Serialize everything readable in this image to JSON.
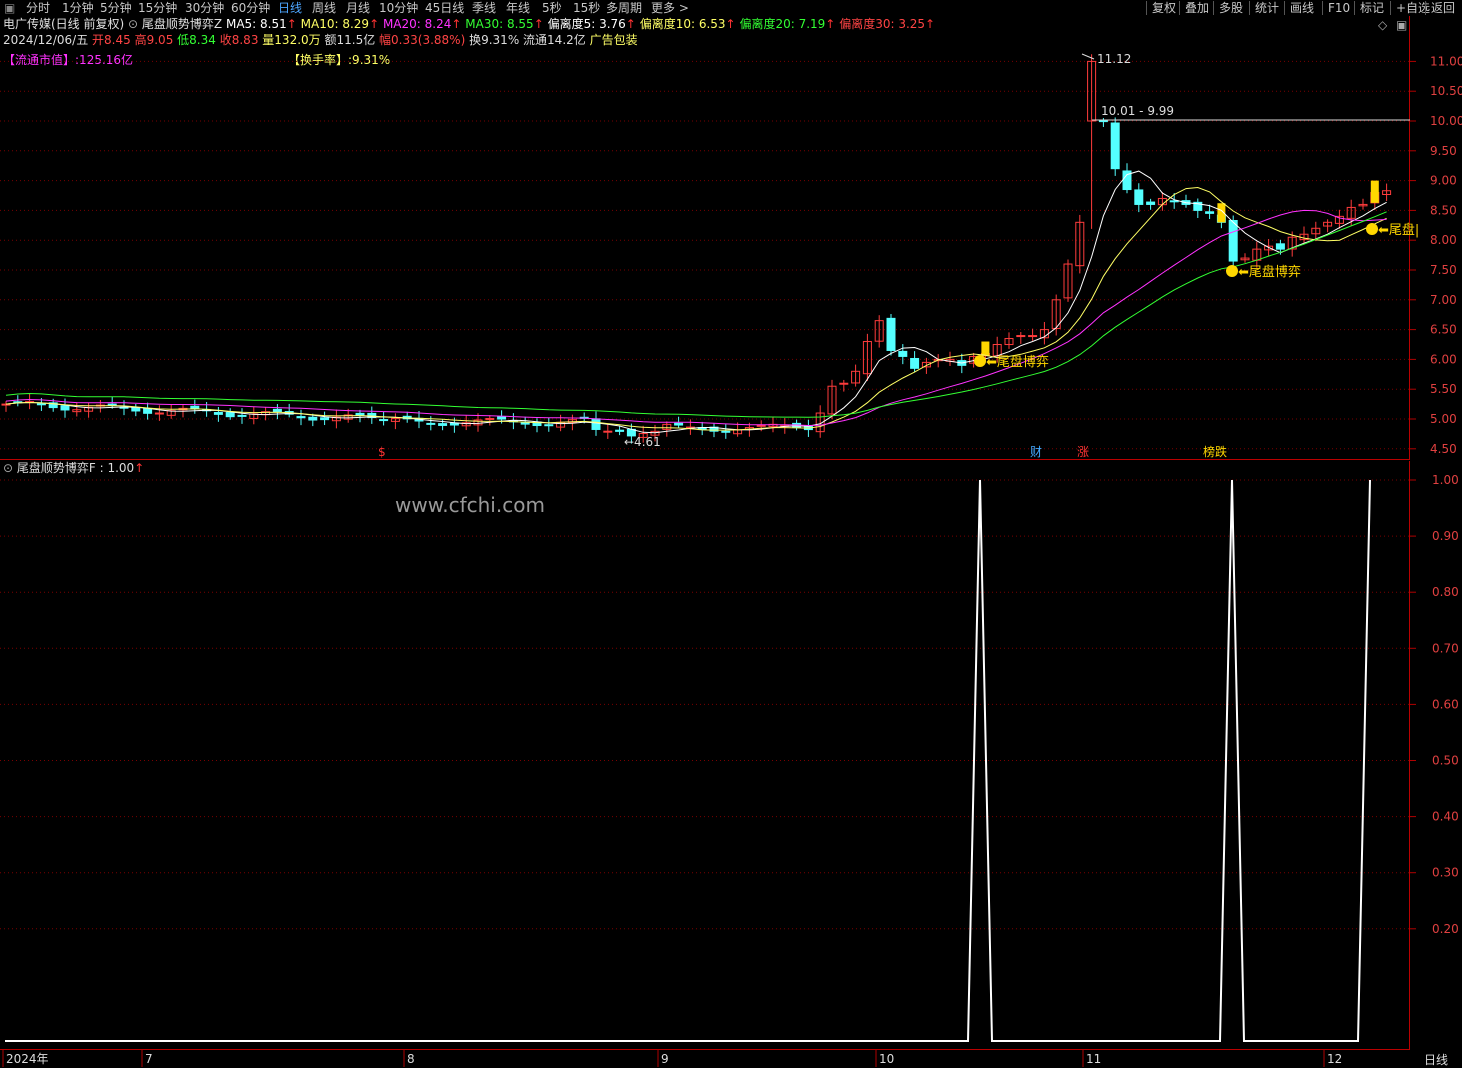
{
  "toolbar": {
    "items": [
      "分时",
      "1分钟",
      "5分钟",
      "15分钟",
      "30分钟",
      "60分钟",
      "日线",
      "周线",
      "月线",
      "10分钟",
      "45日线",
      "季线",
      "年线",
      "5秒",
      "15秒",
      "多周期",
      "更多 >"
    ],
    "active_index": 6,
    "right_items": [
      "复权",
      "叠加",
      "多股",
      "统计",
      "画线",
      "F10",
      "标记",
      "+自选",
      "返回"
    ]
  },
  "stock": {
    "name": "电广传媒(日线 前复权)",
    "indicator": "尾盘顺势博弈Z",
    "ma5": "MA5: 8.51",
    "ma10": "MA10: 8.29",
    "ma20": "MA20: 8.24",
    "ma30": "MA30: 8.55",
    "dev5": "偏离度5: 3.76",
    "dev10": "偏离度10: 6.53",
    "dev20": "偏离度20: 7.19",
    "dev30": "偏离度30: 3.25",
    "date": "2024/12/06/五",
    "open": "开8.45",
    "high": "高9.05",
    "low": "低8.34",
    "close": "收8.83",
    "volume": "量132.0万",
    "amount": "额11.5亿",
    "change": "幅0.33(3.88%)",
    "turnover": "换9.31%",
    "float": "流通14.2亿",
    "sector": "广告包装",
    "float_mv_label": "【流通市值】",
    "float_mv_value": ":125.16亿",
    "turnover_label": "【换手率】",
    "turnover_value": ":9.31%"
  },
  "price_axis": [
    "11.00",
    "10.50",
    "10.00",
    "9.50",
    "9.00",
    "8.50",
    "8.00",
    "7.50",
    "7.00",
    "6.50",
    "6.00",
    "5.50",
    "5.00",
    "4.50"
  ],
  "annotations": {
    "high": "11.12",
    "range": "10.01 - 9.99",
    "low": "4.61",
    "signal": "尾盘博弈",
    "signal_last": "尾盘|",
    "events": [
      "$",
      "财",
      "涨",
      "榜跌"
    ]
  },
  "sub": {
    "title": "尾盘顺势博弈F : 1.00",
    "axis": [
      "1.00",
      "0.90",
      "0.80",
      "0.70",
      "0.60",
      "0.50",
      "0.40",
      "0.30",
      "0.20"
    ],
    "watermark": "www.cfchi.com"
  },
  "date_axis": [
    "2024年",
    "7",
    "8",
    "9",
    "10",
    "11",
    "12"
  ],
  "period_label": "日线",
  "chart_data": {
    "type": "line",
    "title": "尾盘顺势博弈F",
    "signal_values": [
      0,
      0,
      0,
      0,
      0,
      1,
      0,
      0,
      0,
      0,
      1,
      0,
      0,
      0,
      0,
      1
    ],
    "ylim": [
      0,
      1
    ],
    "price_ylim": [
      4.5,
      11.1
    ],
    "price_high": 11.12,
    "price_low": 4.61
  },
  "colors": {
    "up": "#ff3c3c",
    "down": "#54ffff",
    "ma5": "#ffffff",
    "ma10": "#ffff66",
    "ma20": "#ff33ff",
    "ma30": "#33ff33",
    "grid": "#7a0000",
    "frame": "#b00000"
  }
}
